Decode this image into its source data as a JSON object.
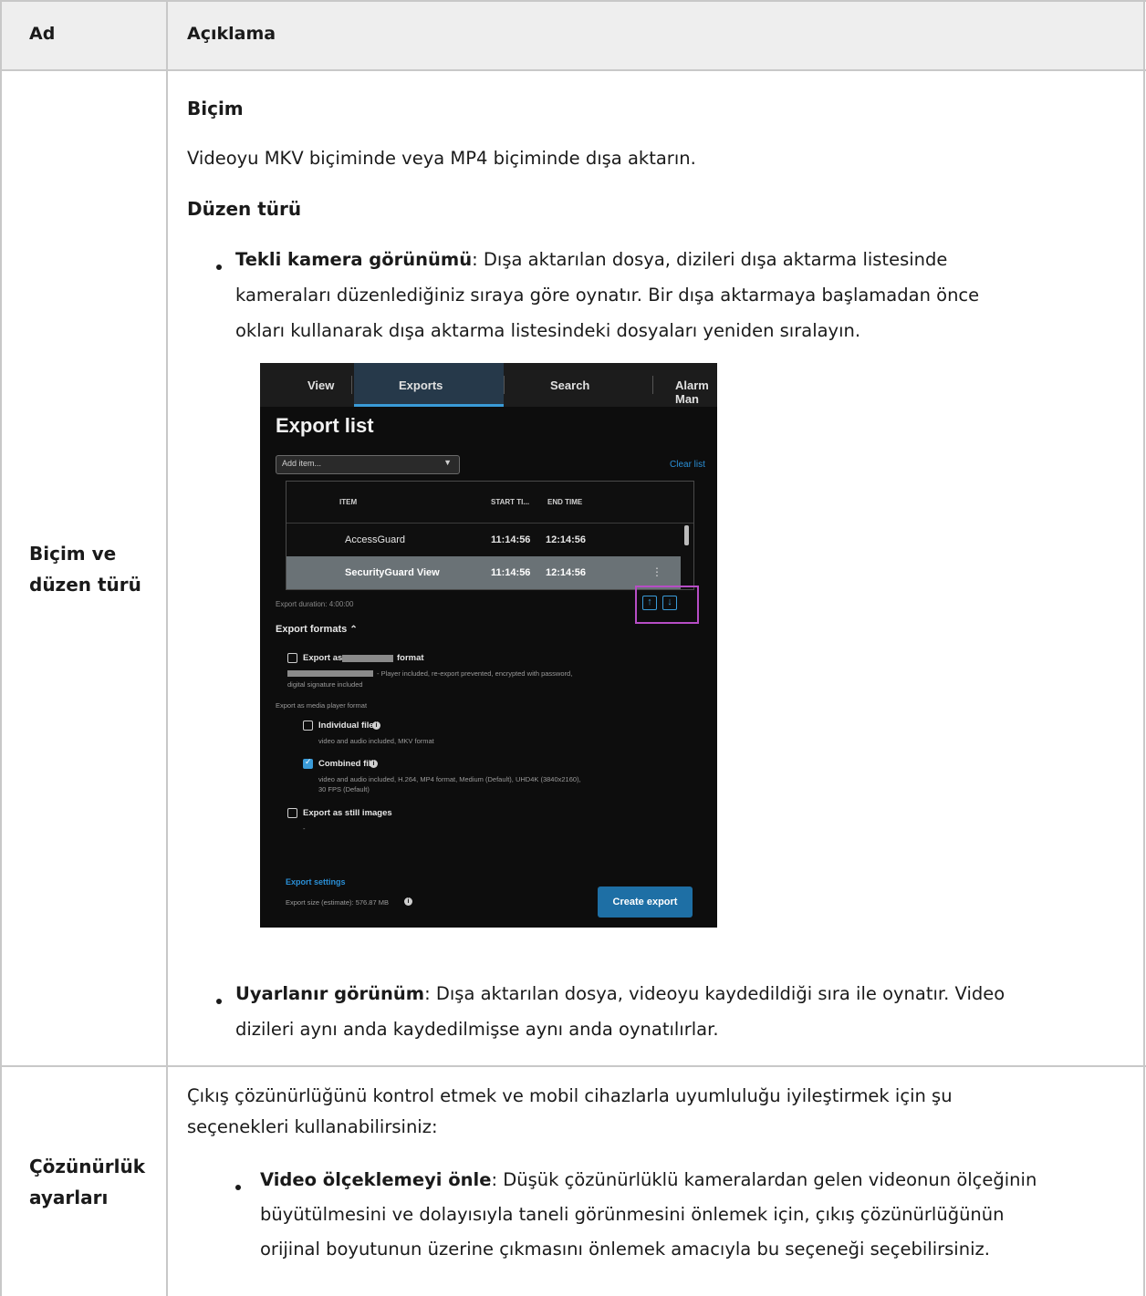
{
  "header": {
    "col1": "Ad",
    "col2": "Açıklama"
  },
  "rows": [
    {
      "name_line1": "Biçim ve",
      "name_line2": "düzen türü",
      "format_heading": "Biçim",
      "format_text": "Videoyu MKV biçiminde veya MP4 biçiminde dışa aktarın.",
      "layout_heading": "Düzen türü",
      "bullet1": {
        "term": "Tekli kamera görünümü",
        "line1": ": Dışa aktarılan dosya, dizileri dışa aktarma listesinde",
        "line2": "kameraları düzenlediğiniz sıraya göre oynatır. Bir dışa aktarmaya başlamadan önce",
        "line3": "okları kullanarak dışa aktarma listesindeki dosyaları yeniden sıralayın."
      },
      "bullet2": {
        "term": "Uyarlanır görünüm",
        "line1": ": Dışa aktarılan dosya, videoyu kaydedildiği sıra ile oynatır. Video",
        "line2": "dizileri aynı anda kaydedilmişse aynı anda oynatılırlar."
      }
    },
    {
      "name_line1": "Çözünürlük",
      "name_line2": "ayarları",
      "intro_line1": "Çıkış çözünürlüğünü kontrol etmek ve mobil cihazlarla uyumluluğu iyileştirmek için şu",
      "intro_line2": "seçenekleri kullanabilirsiniz:",
      "bullet1": {
        "term": "Video ölçeklemeyi önle",
        "line1": ": Düşük çözünürlüklü kameralardan gelen videonun ölçeğinin",
        "line2": "büyütülmesini ve dolayısıyla taneli görünmesini önlemek için, çıkış çözünürlüğünün",
        "line3": "orijinal boyutunun üzerine çıkmasını önlemek amacıyla bu seçeneği seçebilirsiniz."
      }
    }
  ],
  "screenshot": {
    "tabs": [
      "View",
      "Exports",
      "Search",
      "Alarm Man"
    ],
    "active_tab": "Exports",
    "title": "Export list",
    "add_item": "Add item...",
    "clear_list": "Clear list",
    "columns": [
      "ITEM",
      "START TI...",
      "END TIME"
    ],
    "items": [
      {
        "name": "AccessGuard",
        "start": "11:14:56",
        "end": "12:14:56",
        "selected": false
      },
      {
        "name": "SecurityGuard View",
        "start": "11:14:56",
        "end": "12:14:56",
        "selected": true
      }
    ],
    "export_duration": "Export duration: 4:00:00",
    "export_formats": "Export formats",
    "export_as_label": "Export as",
    "format_word": "format",
    "export_as_desc1": "- Player included, re-export prevented, encrypted with password,",
    "export_as_desc2": "digital signature included",
    "media_player_heading": "Export as media player format",
    "individual_files": {
      "label": "Individual files",
      "desc": "video and audio included, MKV format",
      "checked": false
    },
    "combined_file": {
      "label": "Combined file",
      "desc1": "video and audio included, H.264, MP4 format, Medium (Default), UHD4K (3840x2160),",
      "desc2": "30 FPS (Default)",
      "checked": true
    },
    "still_images": {
      "label": "Export as still images",
      "desc": "-",
      "checked": false
    },
    "export_settings": "Export settings",
    "export_size": "Export size (estimate): 576.87 MB",
    "create_export": "Create export",
    "highlight_color": "#b64dc5",
    "accent_color": "#3a9bd8"
  }
}
